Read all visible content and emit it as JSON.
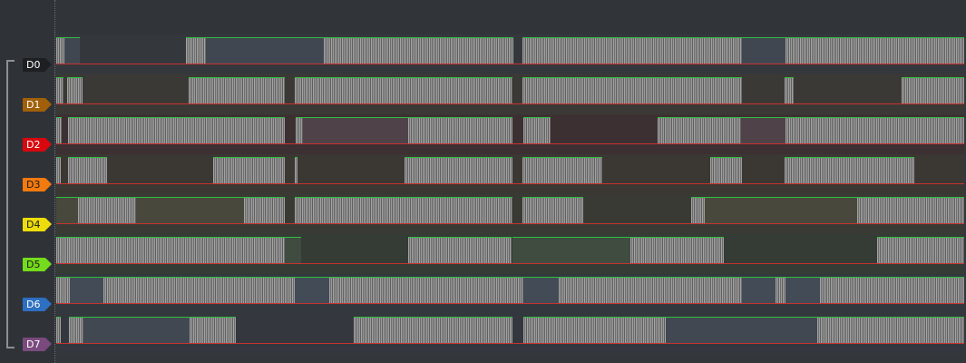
{
  "channels": [
    {
      "label": "D0",
      "tag_color": "#1d1f22",
      "tag_text_color": "#ffffff",
      "row_tint": "#34383d",
      "high_fill": "#414751",
      "segments": [
        [
          "b",
          0.0,
          0.9
        ],
        [
          "h",
          0.9,
          2.6
        ],
        [
          "l",
          2.6,
          14.3
        ],
        [
          "b",
          14.3,
          16.5
        ],
        [
          "h",
          16.5,
          29.5
        ],
        [
          "b",
          29.5,
          50.4
        ],
        [
          "l",
          50.4,
          51.3
        ],
        [
          "b",
          51.3,
          75.5
        ],
        [
          "h",
          75.5,
          80.3
        ],
        [
          "b",
          80.3,
          100.0
        ]
      ]
    },
    {
      "label": "D1",
      "tag_color": "#a05f08",
      "tag_text_color": "#ffffff",
      "row_tint": "#3b3935",
      "high_fill": "#494439",
      "segments": [
        [
          "b",
          0.0,
          0.8
        ],
        [
          "l",
          0.8,
          1.2
        ],
        [
          "b",
          1.2,
          2.9
        ],
        [
          "l",
          2.9,
          14.6
        ],
        [
          "b",
          14.6,
          25.2
        ],
        [
          "l",
          25.2,
          26.3
        ],
        [
          "b",
          26.3,
          50.3
        ],
        [
          "l",
          50.3,
          51.3
        ],
        [
          "b",
          51.3,
          75.5
        ],
        [
          "l",
          75.5,
          80.2
        ],
        [
          "b",
          80.2,
          81.2
        ],
        [
          "l",
          81.2,
          93.1
        ],
        [
          "b",
          93.1,
          100.0
        ]
      ]
    },
    {
      "label": "D2",
      "tag_color": "#d8080e",
      "tag_text_color": "#ffffff",
      "row_tint": "#3c3033",
      "high_fill": "#4f4349",
      "segments": [
        [
          "b",
          0.0,
          0.6
        ],
        [
          "l",
          0.6,
          1.3
        ],
        [
          "b",
          1.3,
          25.2
        ],
        [
          "l",
          25.2,
          26.4
        ],
        [
          "b",
          26.4,
          27.2
        ],
        [
          "h",
          27.2,
          38.8
        ],
        [
          "b",
          38.8,
          50.3
        ],
        [
          "l",
          50.3,
          51.4
        ],
        [
          "b",
          51.4,
          54.4
        ],
        [
          "l",
          54.4,
          66.2
        ],
        [
          "b",
          66.2,
          75.4
        ],
        [
          "h",
          75.4,
          80.3
        ],
        [
          "b",
          80.3,
          100.0
        ]
      ]
    },
    {
      "label": "D3",
      "tag_color": "#f37a0e",
      "tag_text_color": "#1a1a1a",
      "row_tint": "#3b3733",
      "high_fill": "#474238",
      "segments": [
        [
          "b",
          0.0,
          0.5
        ],
        [
          "l",
          0.5,
          1.3
        ],
        [
          "b",
          1.3,
          5.6
        ],
        [
          "l",
          5.6,
          17.3
        ],
        [
          "b",
          17.3,
          25.2
        ],
        [
          "l",
          25.2,
          26.3
        ],
        [
          "b",
          26.3,
          26.6
        ],
        [
          "l",
          26.6,
          38.4
        ],
        [
          "b",
          38.4,
          50.3
        ],
        [
          "l",
          50.3,
          51.3
        ],
        [
          "b",
          51.3,
          60.1
        ],
        [
          "l",
          60.1,
          72.0
        ],
        [
          "b",
          72.0,
          75.5
        ],
        [
          "l",
          75.5,
          80.2
        ],
        [
          "b",
          80.2,
          94.5
        ],
        [
          "l",
          94.5,
          100.0
        ]
      ]
    },
    {
      "label": "D4",
      "tag_color": "#eddd0c",
      "tag_text_color": "#1a1a1a",
      "row_tint": "#393a33",
      "high_fill": "#48493c",
      "segments": [
        [
          "h",
          0.0,
          2.4
        ],
        [
          "b",
          2.4,
          8.8
        ],
        [
          "h",
          8.8,
          20.7
        ],
        [
          "b",
          20.7,
          25.2
        ],
        [
          "l",
          25.2,
          26.3
        ],
        [
          "b",
          26.3,
          50.3
        ],
        [
          "l",
          50.3,
          51.3
        ],
        [
          "b",
          51.3,
          58.0
        ],
        [
          "l",
          58.0,
          69.9
        ],
        [
          "b",
          69.9,
          71.4
        ],
        [
          "h",
          71.4,
          88.2
        ],
        [
          "b",
          88.2,
          100.0
        ]
      ]
    },
    {
      "label": "D5",
      "tag_color": "#74dc1c",
      "tag_text_color": "#1a1a1a",
      "row_tint": "#353b35",
      "high_fill": "#414c41",
      "segments": [
        [
          "b",
          0.0,
          1.4
        ],
        [
          "b",
          1.4,
          25.2
        ],
        [
          "h",
          25.2,
          27.0
        ],
        [
          "l",
          27.0,
          38.8
        ],
        [
          "b",
          38.8,
          50.2
        ],
        [
          "h",
          50.2,
          63.2
        ],
        [
          "b",
          63.2,
          73.5
        ],
        [
          "l",
          73.5,
          90.4
        ],
        [
          "b",
          90.4,
          100.0
        ]
      ]
    },
    {
      "label": "D6",
      "tag_color": "#2d6fc1",
      "tag_text_color": "#ffffff",
      "row_tint": "#33383e",
      "high_fill": "#434b56",
      "segments": [
        [
          "b",
          0.0,
          1.5
        ],
        [
          "h",
          1.5,
          5.2
        ],
        [
          "b",
          5.2,
          26.3
        ],
        [
          "h",
          26.3,
          30.1
        ],
        [
          "b",
          30.1,
          51.4
        ],
        [
          "h",
          51.4,
          55.3
        ],
        [
          "b",
          55.3,
          75.5
        ],
        [
          "h",
          75.5,
          79.2
        ],
        [
          "b",
          79.2,
          80.3
        ],
        [
          "h",
          80.3,
          84.1
        ],
        [
          "b",
          84.1,
          100.0
        ]
      ]
    },
    {
      "label": "D7",
      "tag_color": "#7a4a7e",
      "tag_text_color": "#ffffff",
      "row_tint": "#34373d",
      "high_fill": "#424852",
      "segments": [
        [
          "b",
          0.0,
          0.5
        ],
        [
          "l",
          0.5,
          1.4
        ],
        [
          "b",
          1.4,
          3.0
        ],
        [
          "h",
          3.0,
          14.7
        ],
        [
          "b",
          14.7,
          19.8
        ],
        [
          "l",
          19.8,
          32.8
        ],
        [
          "b",
          32.8,
          50.3
        ],
        [
          "l",
          50.3,
          51.4
        ],
        [
          "b",
          51.4,
          67.1
        ],
        [
          "h",
          67.1,
          83.8
        ],
        [
          "b",
          83.8,
          100.0
        ]
      ]
    }
  ]
}
